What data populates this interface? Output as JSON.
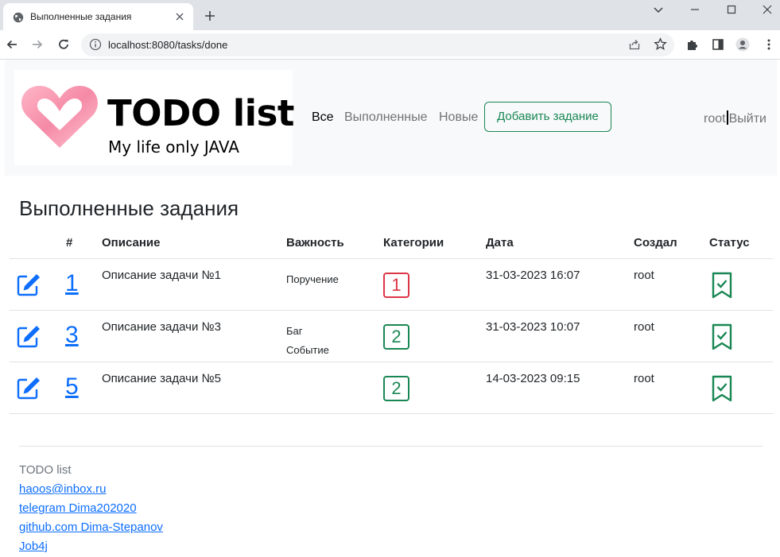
{
  "browser": {
    "tab_title": "Выполненные задания",
    "url": "localhost:8080/tasks/done"
  },
  "navbar": {
    "logo_title": "TODO list",
    "logo_subtitle": "My life only JAVA",
    "links": [
      {
        "label": "Все",
        "active": true
      },
      {
        "label": "Выполненные",
        "active": false
      },
      {
        "label": "Новые",
        "active": false
      }
    ],
    "add_button": "Добавить задание",
    "user": "root",
    "logout": "Выйти"
  },
  "main": {
    "heading": "Выполненные задания",
    "columns": [
      "#",
      "Описание",
      "Важность",
      "Категории",
      "Дата",
      "Создал",
      "Статус"
    ],
    "rows": [
      {
        "id": "1",
        "description": "Описание задачи №1",
        "priority": [
          "Поручение"
        ],
        "category": "1",
        "category_color": "#dc3545",
        "date": "31-03-2023 16:07",
        "author": "root"
      },
      {
        "id": "3",
        "description": "Описание задачи №3",
        "priority": [
          "Баг",
          "Событие"
        ],
        "category": "2",
        "category_color": "#198754",
        "date": "31-03-2023 10:07",
        "author": "root"
      },
      {
        "id": "5",
        "description": "Описание задачи №5",
        "priority": [],
        "category": "2",
        "category_color": "#198754",
        "date": "14-03-2023 09:15",
        "author": "root"
      }
    ]
  },
  "footer": {
    "title": "TODO list",
    "links": [
      "haoos@inbox.ru",
      "telegram Dima202020",
      "github.com Dima-Stepanov",
      "Job4j"
    ]
  },
  "colors": {
    "primary": "#0d6efd",
    "success": "#198754",
    "danger": "#dc3545"
  },
  "icons": {
    "edit": "pencil-square-icon",
    "status": "bookmark-check-icon",
    "logo": "heart-logo-icon"
  }
}
